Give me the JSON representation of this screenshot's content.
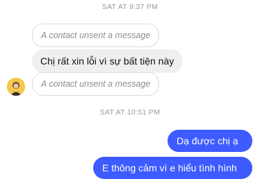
{
  "thread": {
    "timestamp_1": "SAT AT 9:37 PM",
    "timestamp_2": "SAT AT 10:51 PM",
    "unsent_1": "A contact unsent a message",
    "incoming_1": "Chị rất xin lỗi vì sự bất tiện này",
    "unsent_2": "A contact unsent a message",
    "outgoing_1": "Dạ được chị ạ",
    "outgoing_2": "E thông cảm vì e hiểu tình hình"
  },
  "colors": {
    "outgoing_bubble": "#3d5bff",
    "incoming_bubble": "#efefef",
    "timestamp_text": "#9a9a9a"
  },
  "icons": {
    "avatar": "contact-avatar-icon"
  }
}
